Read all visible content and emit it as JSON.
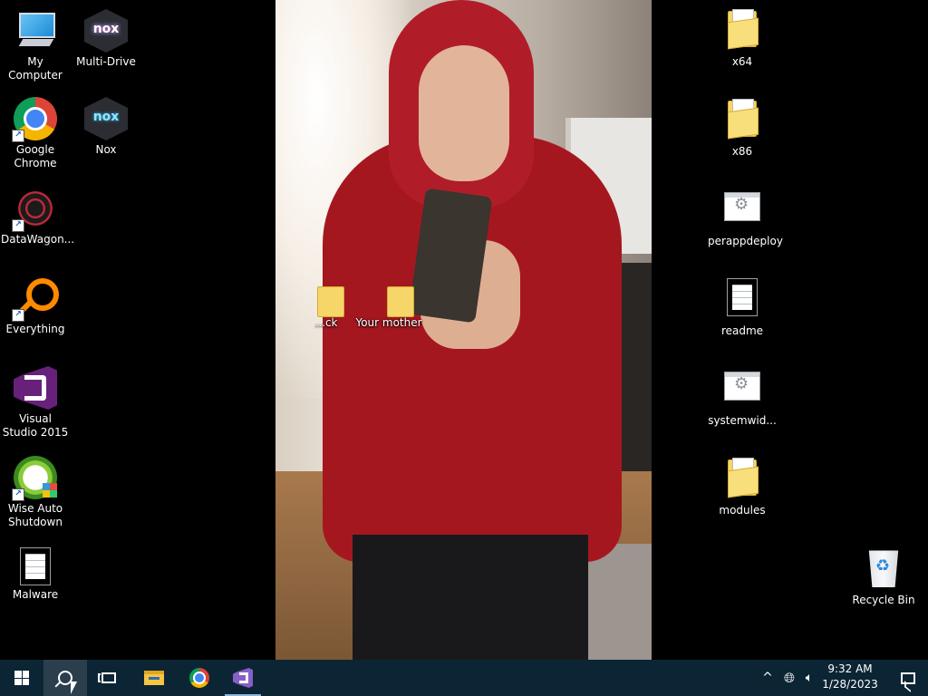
{
  "desktop": {
    "left_column": [
      {
        "label": "My Computer",
        "icon": "computer-icon"
      },
      {
        "label": "Multi-Drive",
        "icon": "nox-multi-drive-icon"
      },
      {
        "label": "Google\nChrome",
        "icon": "chrome-icon"
      },
      {
        "label": "Nox",
        "icon": "nox-icon"
      },
      {
        "label": "DataWagon...",
        "icon": "datawagon-icon"
      },
      {
        "label": "Everything",
        "icon": "everything-icon"
      },
      {
        "label": "Visual Studio 2015",
        "icon": "visual-studio-icon"
      },
      {
        "label": "Wise Auto Shutdown",
        "icon": "wise-auto-shutdown-icon"
      },
      {
        "label": "Malware",
        "icon": "text-document-icon"
      }
    ],
    "center": [
      {
        "label": "...ck",
        "icon": "folder-icon"
      },
      {
        "label": "Your mother",
        "icon": "folder-icon"
      }
    ],
    "right_column": [
      {
        "label": "x64",
        "icon": "folder-icon"
      },
      {
        "label": "x86",
        "icon": "folder-icon"
      },
      {
        "label": "perappdeploy",
        "icon": "config-file-icon"
      },
      {
        "label": "readme",
        "icon": "text-document-icon"
      },
      {
        "label": "systemwid...",
        "icon": "config-file-icon"
      },
      {
        "label": "modules",
        "icon": "folder-icon"
      },
      {
        "label": "Recycle Bin",
        "icon": "recycle-bin-icon"
      }
    ]
  },
  "taskbar": {
    "pinned": [
      "start-icon",
      "search-icon",
      "task-view-icon",
      "file-explorer-icon",
      "chrome-icon",
      "visual-studio-icon"
    ],
    "tray": {
      "chevron": "^",
      "network_icon": "globe-icon",
      "volume_icon": "speaker-icon"
    },
    "clock": {
      "time": "9:32 AM",
      "date": "1/28/2023"
    },
    "notification_icon": "action-center-icon"
  },
  "colors": {
    "taskbar_bg": "#0c2534",
    "desktop_bg": "#000000",
    "taskbar_active": "#2b3e4c"
  }
}
